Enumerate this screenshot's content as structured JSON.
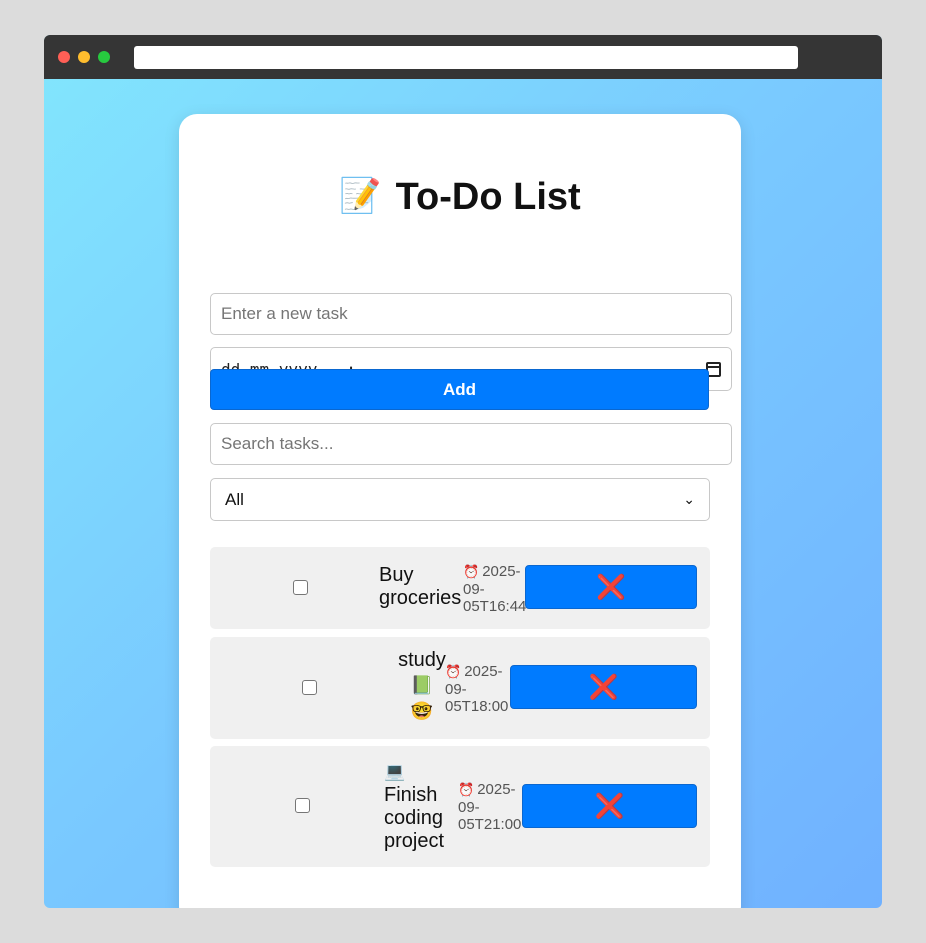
{
  "app": {
    "title_emoji": "📝",
    "title": "To-Do List"
  },
  "inputs": {
    "new_task_placeholder": "Enter a new task",
    "datetime_placeholder": "dd-mm-yyyy --:--",
    "add_label": "Add",
    "search_placeholder": "Search tasks...",
    "filter_selected": "All"
  },
  "tasks": [
    {
      "name_line1": "Buy",
      "name_line2": "groceries",
      "alarm": "⏰",
      "date_line1": "2025-",
      "date_line2": "09-",
      "date_line3": "05T16:44",
      "delete_label": "❌",
      "completed": false
    },
    {
      "name_line1": "study",
      "name_line2": "📗",
      "name_line3": "🤓",
      "alarm": "⏰",
      "date_line1": "2025-",
      "date_line2": "09-",
      "date_line3": "05T18:00",
      "delete_label": "❌",
      "completed": false
    },
    {
      "name_line1": "💻",
      "name_line2": "Finish",
      "name_line3": "coding",
      "name_line4": "project",
      "alarm": "⏰",
      "date_line1": "2025-",
      "date_line2": "09-",
      "date_line3": "05T21:00",
      "delete_label": "❌",
      "completed": false
    }
  ],
  "colors": {
    "accent": "#007bff",
    "delete_icon": "#f0506e",
    "task_bg": "#f0f0f0"
  }
}
